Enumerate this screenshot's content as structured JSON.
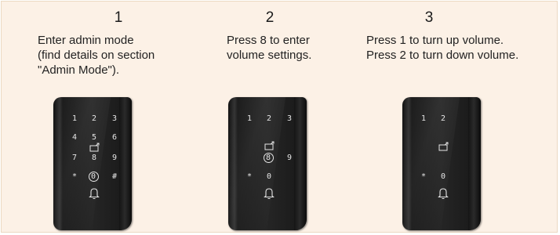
{
  "steps": [
    {
      "number": "1",
      "text": "Enter admin mode\n(find details on section\n\"Admin Mode\")."
    },
    {
      "number": "2",
      "text": "Press 8 to enter\nvolume settings."
    },
    {
      "number": "3",
      "text": "Press 1 to turn up volume.\nPress 2 to turn down volume."
    }
  ],
  "keypads": {
    "full": [
      "1",
      "2",
      "3",
      "4",
      "5",
      "6",
      "7",
      "8",
      "9",
      "*",
      "0",
      "#"
    ],
    "step2": [
      "1",
      "2",
      "3",
      "8",
      "9",
      "*",
      "0"
    ],
    "step3": [
      "1",
      "2",
      "*",
      "0"
    ]
  },
  "colors": {
    "panel_bg": "#fcf1e6",
    "lock_body": "#1f1f1f",
    "key_glyph": "#e6e6e6"
  },
  "icons": [
    "enter-icon",
    "bell-icon"
  ]
}
